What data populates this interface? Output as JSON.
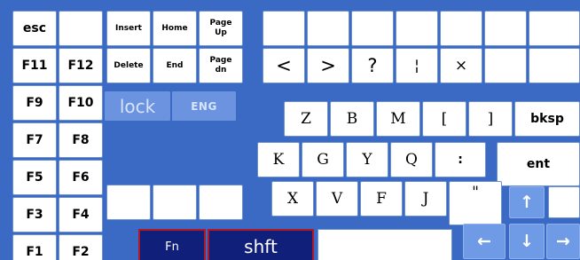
{
  "keys": {
    "esc": "esc",
    "blank": "",
    "f1": "F1",
    "f2": "F2",
    "f3": "F3",
    "f4": "F4",
    "f5": "F5",
    "f6": "F6",
    "f7": "F7",
    "f8": "F8",
    "f9": "F9",
    "f10": "F10",
    "f11": "F11",
    "f12": "F12",
    "insert": "Insert",
    "home": "Home",
    "page_up": "Page\nUp",
    "delete": "Delete",
    "end": "End",
    "page_dn": "Page\ndn",
    "less_than": "<",
    "greater_than": ">",
    "question": "?",
    "pipe": "¦",
    "times": "×",
    "z": "Z",
    "b": "B",
    "m": "M",
    "bracket_open": "[",
    "bracket_close": "]",
    "bksp": "bksp",
    "k": "K",
    "g": "G",
    "y": "Y",
    "q": "Q",
    "colon": ":",
    "ent": "ent",
    "x": "X",
    "v": "V",
    "f": "F",
    "j": "J",
    "quote": "\"",
    "fn": "Fn",
    "shft": "shft",
    "arrow_up": "↑",
    "arrow_left": "←",
    "arrow_down": "↓",
    "arrow_right": "→"
  },
  "toggles": {
    "lock": "lock",
    "lang": "ENG"
  },
  "colors": {
    "background": "#3a6ac4",
    "key": "#ffffff",
    "toggle": "#6b93e0",
    "modifier": "#10207a",
    "modifier_border": "#b01828",
    "arrow_key": "#6f9ae6"
  }
}
